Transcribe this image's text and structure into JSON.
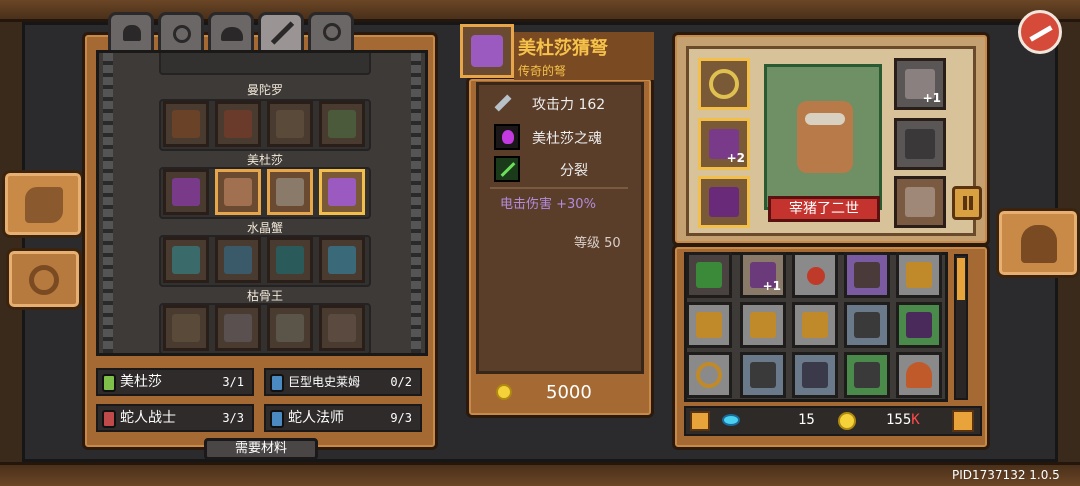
{
  "weapon": {
    "name": "美杜莎猜弩",
    "subtitle": "传奇的弩",
    "stats": [
      {
        "icon": "sword-icon",
        "text": "攻击力 162"
      },
      {
        "icon": "purple-soul-icon",
        "text": "美杜莎之魂"
      },
      {
        "icon": "split-arrows-icon",
        "text": "分裂"
      }
    ],
    "bonus": "电击伤害 +30%",
    "level": "等级 50",
    "cost": "5000"
  },
  "categories": [
    {
      "name": "曼陀罗"
    },
    {
      "name": "美杜莎"
    },
    {
      "name": "水晶蟹"
    },
    {
      "name": "枯骨王"
    }
  ],
  "materials": [
    {
      "name": "美杜莎",
      "count": "3/1",
      "color": "#7fc04a"
    },
    {
      "name": "巨型电史莱姆",
      "count": "0/2",
      "color": "#4a8ac0"
    },
    {
      "name": "蛇人战士",
      "count": "3/3",
      "color": "#c04a4a"
    },
    {
      "name": "蛇人法师",
      "count": "9/3",
      "color": "#4a8ac0"
    }
  ],
  "need_materials_label": "需要材料",
  "hero": {
    "name": "宰猪了二世",
    "badges": [
      "+1",
      "+2"
    ]
  },
  "inventory_badge": "+1",
  "currency": {
    "gems": "15",
    "coins": "155",
    "coins_suffix": "K"
  },
  "version": "PID1737132 1.0.5",
  "colors": {
    "accent": "#f2c04a",
    "panel": "#a56a33",
    "bonus_text": "#b48bdc"
  }
}
